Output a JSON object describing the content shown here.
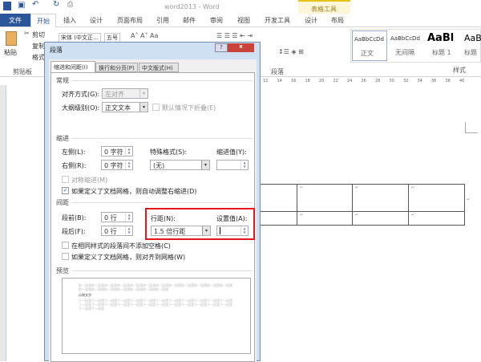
{
  "window": {
    "title": "word2013 - Word",
    "context_tab_group": "表格工具"
  },
  "tabs": [
    "文件",
    "开始",
    "插入",
    "设计",
    "页面布局",
    "引用",
    "邮件",
    "审阅",
    "视图",
    "开发工具",
    "设计",
    "布局"
  ],
  "ribbon": {
    "clipboard": {
      "paste": "粘贴",
      "cut": "剪切",
      "copy": "复制",
      "format": "格式",
      "group": "剪贴板"
    },
    "font": {
      "name": "宋体 (中文正…",
      "size": "五号"
    },
    "paragraph_group": "段落",
    "styles": {
      "items": [
        {
          "preview": "AaBbCcDd",
          "name": "正文"
        },
        {
          "preview": "AaBbCcDd",
          "name": "无间隔"
        },
        {
          "preview": "AaBl",
          "name": "标题 1"
        },
        {
          "preview": "AaB",
          "name": "标题"
        }
      ],
      "group": "样式"
    }
  },
  "ruler": [
    "12",
    "14",
    "16",
    "18",
    "20",
    "22",
    "24",
    "26",
    "28",
    "30",
    "32",
    "34",
    "36",
    "38",
    "40"
  ],
  "dialog": {
    "title": "段落",
    "help": "?",
    "close": "x",
    "tabs": [
      "缩进和间距(I)",
      "换行和分页(P)",
      "中文版式(H)"
    ],
    "general": {
      "heading": "常规",
      "alignment_label": "对齐方式(G):",
      "alignment_value": "左对齐",
      "outline_label": "大纲级别(O):",
      "outline_value": "正文文本",
      "collapse_label": "默认情况下折叠(E)"
    },
    "indent": {
      "heading": "缩进",
      "left_label": "左侧(L):",
      "left_value": "0 字符",
      "right_label": "右侧(R):",
      "right_value": "0 字符",
      "special_label": "特殊格式(S):",
      "special_value": "(无)",
      "by_label": "缩进值(Y):",
      "by_value": "",
      "mirror_label": "对称缩进(M)",
      "auto_adjust_label": "如果定义了文档网格，则自动调整右缩进(D)",
      "auto_adjust_checked": true
    },
    "spacing": {
      "heading": "间距",
      "before_label": "段前(B):",
      "before_value": "0 行",
      "after_label": "段后(F):",
      "after_value": "0 行",
      "line_label": "行距(N):",
      "line_value": "1.5 倍行距",
      "at_label": "设置值(A):",
      "at_value": "",
      "no_space_label": "在相同样式的段落间不添加空格(C)",
      "snap_label": "如果定义了文档网格，则对齐到网格(W)"
    },
    "preview": {
      "heading": "预览",
      "prev_text": "前一段落前一段落前一段落前一段落前一段落前一段落前一段落前一段落前一段落前一段落前一段落前一段落前一段落前一段落前一段落前一段落前一段落前一段落前一段落",
      "sample": "示例文字",
      "next_text": "下一段落下一段落下一段落下一段落下一段落下一段落下一段落下一段落下一段落下一段落下一段落下一段落下一段落下一段落下一段落下一段落下一段落下一段落下一段落下一段落下一段落下一段落下一段落下一段落下一段落下一段落"
    }
  },
  "colors": {
    "file_tab": "#2b579a",
    "highlight_box": "#e8151b",
    "context_tab": "#fdf6d9"
  },
  "table": {
    "mark": "↵"
  }
}
